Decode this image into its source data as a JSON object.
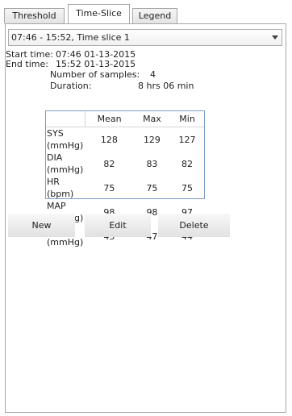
{
  "tabs": [
    {
      "label": "Threshold",
      "active": false
    },
    {
      "label": "Time-Slice",
      "active": true
    },
    {
      "label": "Legend",
      "active": false
    }
  ],
  "slice_select": {
    "value": "07:46 - 15:52, Time slice 1"
  },
  "summary": {
    "start_label": "Start time:",
    "start_value": "07:46 01-13-2015",
    "end_label": "End time:",
    "end_value": "15:52 01-13-2015",
    "samples_label": "Number of samples:",
    "samples_value": "4",
    "duration_label": "Duration:",
    "duration_value": "8 hrs 06 min"
  },
  "stats_table": {
    "columns": [
      "Mean",
      "Max",
      "Min"
    ],
    "rows": [
      {
        "label": "SYS (mmHg)",
        "values": [
          "128",
          "129",
          "127"
        ]
      },
      {
        "label": "DIA (mmHg)",
        "values": [
          "82",
          "83",
          "82"
        ]
      },
      {
        "label": "HR (bpm)",
        "values": [
          "75",
          "75",
          "75"
        ]
      },
      {
        "label": "MAP (mmHg)",
        "values": [
          "98",
          "98",
          "97"
        ]
      },
      {
        "label": "PP (mmHg)",
        "values": [
          "45",
          "47",
          "44"
        ]
      }
    ]
  },
  "buttons": {
    "new": "New",
    "edit": "Edit",
    "delete": "Delete"
  }
}
